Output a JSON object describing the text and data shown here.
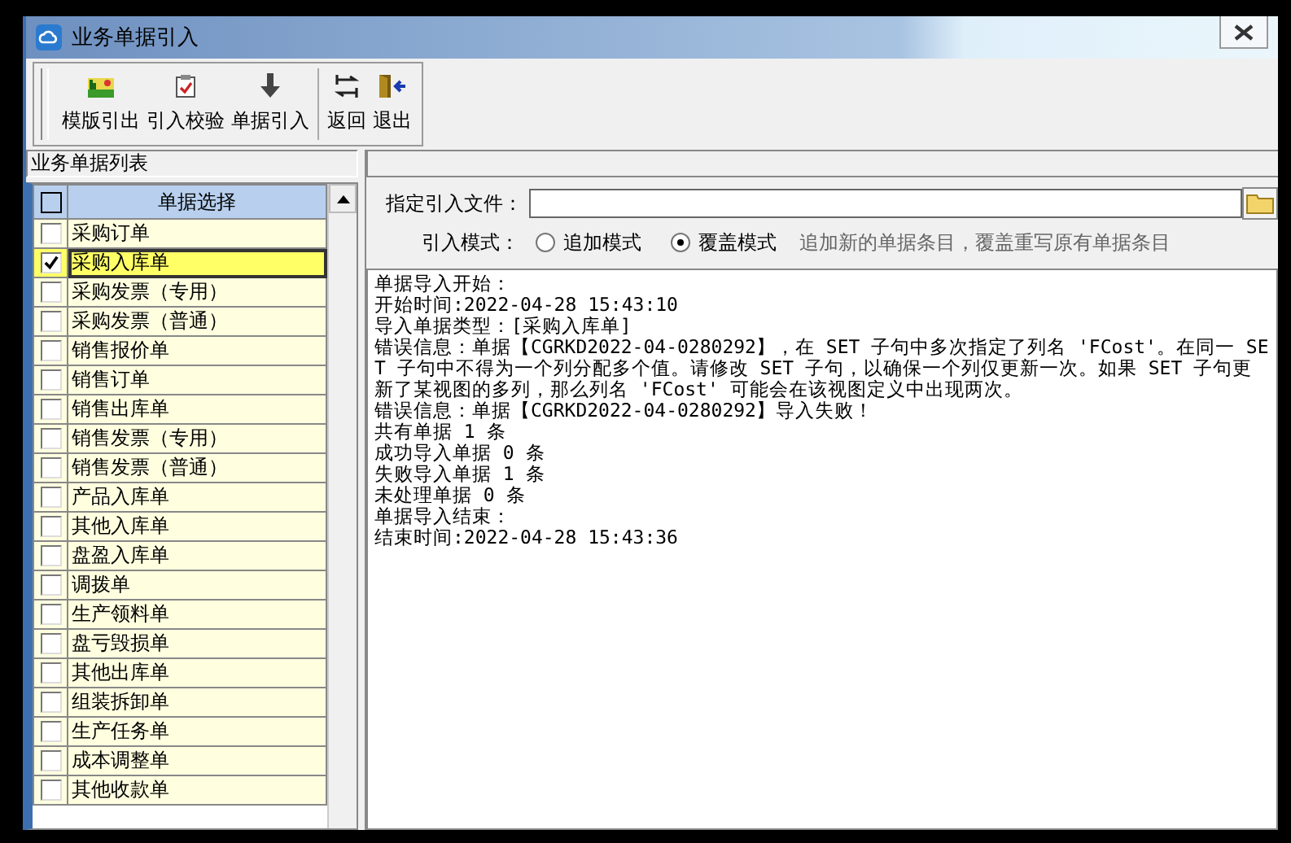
{
  "window": {
    "title": "业务单据引入"
  },
  "toolbar": [
    {
      "label": "模版引出",
      "kind": "picture-icon"
    },
    {
      "label": "引入校验",
      "kind": "check"
    },
    {
      "label": "单据引入",
      "kind": "down"
    },
    {
      "label": "返回",
      "kind": "back",
      "separator_before": true
    },
    {
      "label": "退出",
      "kind": "exit"
    }
  ],
  "list_panel": {
    "title": "业务单据列表",
    "header_checked": false,
    "column": "单据选择",
    "items": [
      {
        "label": "采购订单",
        "checked": false,
        "selected": false
      },
      {
        "label": "采购入库单",
        "checked": true,
        "selected": true
      },
      {
        "label": "采购发票（专用）",
        "checked": false,
        "selected": false
      },
      {
        "label": "采购发票（普通）",
        "checked": false,
        "selected": false
      },
      {
        "label": "销售报价单",
        "checked": false,
        "selected": false
      },
      {
        "label": "销售订单",
        "checked": false,
        "selected": false
      },
      {
        "label": "销售出库单",
        "checked": false,
        "selected": false
      },
      {
        "label": "销售发票（专用）",
        "checked": false,
        "selected": false
      },
      {
        "label": "销售发票（普通）",
        "checked": false,
        "selected": false
      },
      {
        "label": "产品入库单",
        "checked": false,
        "selected": false
      },
      {
        "label": "其他入库单",
        "checked": false,
        "selected": false
      },
      {
        "label": "盘盈入库单",
        "checked": false,
        "selected": false
      },
      {
        "label": "调拨单",
        "checked": false,
        "selected": false
      },
      {
        "label": "生产领料单",
        "checked": false,
        "selected": false
      },
      {
        "label": "盘亏毁损单",
        "checked": false,
        "selected": false
      },
      {
        "label": "其他出库单",
        "checked": false,
        "selected": false
      },
      {
        "label": "组装拆卸单",
        "checked": false,
        "selected": false
      },
      {
        "label": "生产任务单",
        "checked": false,
        "selected": false
      },
      {
        "label": "成本调整单",
        "checked": false,
        "selected": false
      },
      {
        "label": "其他收款单",
        "checked": false,
        "selected": false
      }
    ]
  },
  "file_row": {
    "label": "指定引入文件："
  },
  "mode_row": {
    "label": "引入模式：",
    "options": [
      {
        "label": "追加模式",
        "selected": false
      },
      {
        "label": "覆盖模式",
        "selected": true
      }
    ],
    "hint": "追加新的单据条目，覆盖重写原有单据条目"
  },
  "log": [
    "单据导入开始：",
    "开始时间:2022-04-28 15:43:10",
    "导入单据类型：[采购入库单]",
    "错误信息：单据【CGRKD2022-04-0280292】，在 SET 子句中多次指定了列名 'FCost'。在同一 SET 子句中不得为一个列分配多个值。请修改 SET 子句，以确保一个列仅更新一次。如果 SET 子句更新了某视图的多列，那么列名 'FCost' 可能会在该视图定义中出现两次。",
    "错误信息：单据【CGRKD2022-04-0280292】导入失败！",
    "共有单据 1 条",
    "成功导入单据 0 条",
    "失败导入单据 1 条",
    "未处理单据 0 条",
    "单据导入结束：",
    "结束时间:2022-04-28 15:43:36"
  ]
}
